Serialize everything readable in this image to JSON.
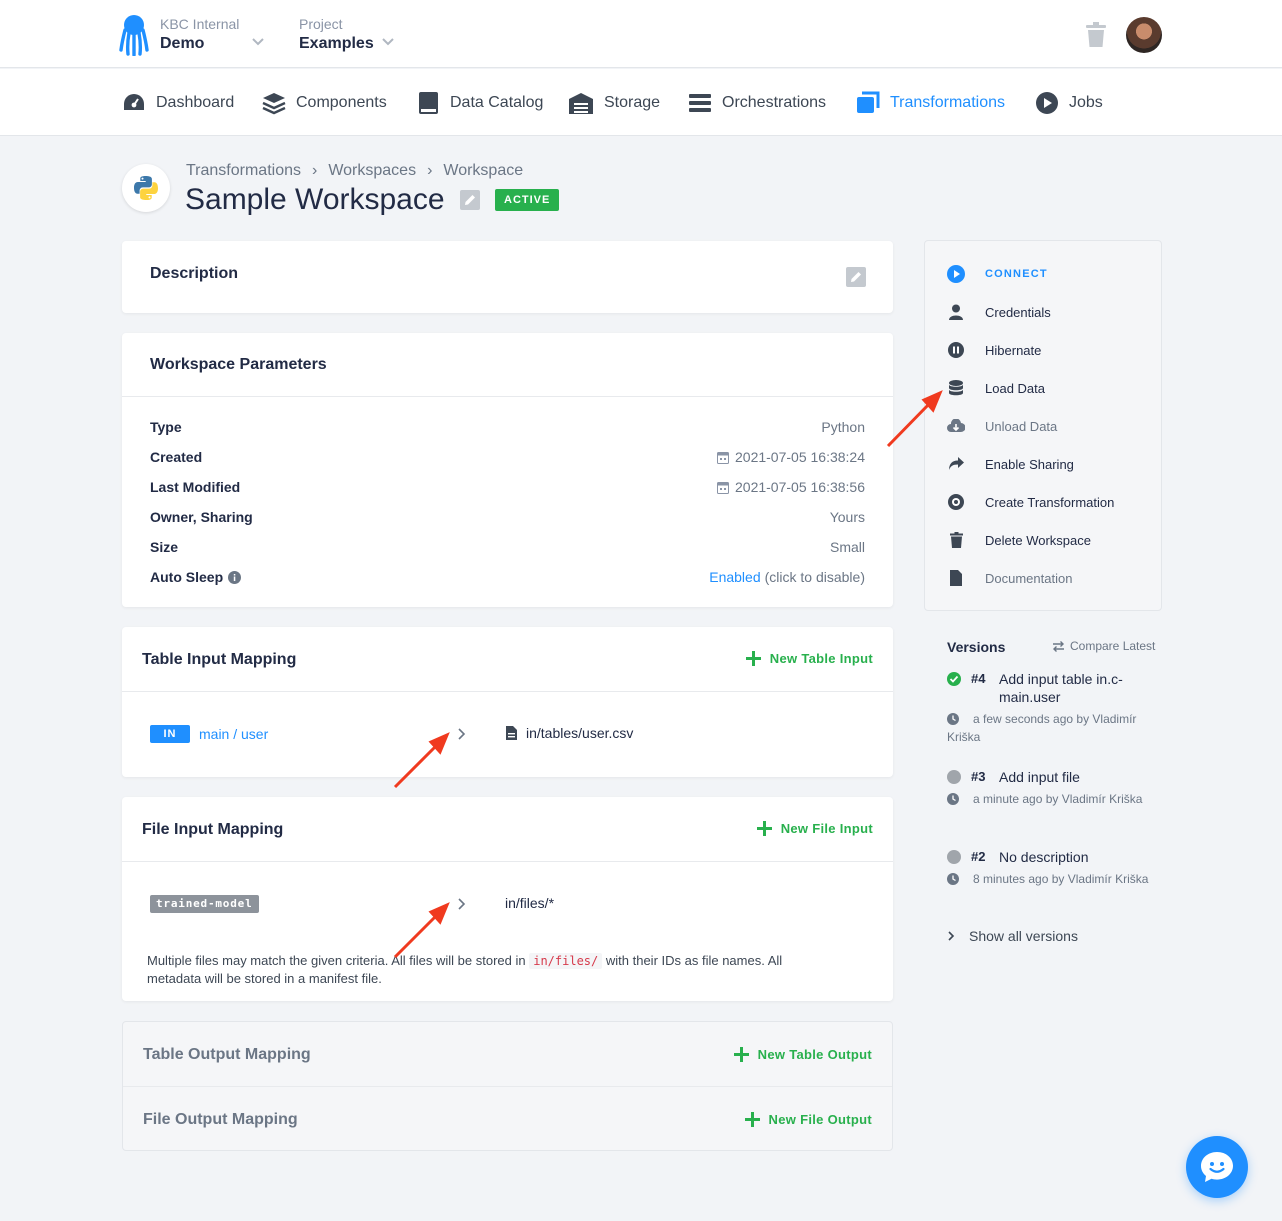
{
  "topbar": {
    "org_label": "KBC Internal",
    "org_value": "Demo",
    "project_label": "Project",
    "project_value": "Examples"
  },
  "nav": {
    "items": [
      {
        "label": "Dashboard",
        "icon": "gauge-icon"
      },
      {
        "label": "Components",
        "icon": "layers-icon"
      },
      {
        "label": "Data Catalog",
        "icon": "book-icon"
      },
      {
        "label": "Storage",
        "icon": "warehouse-icon"
      },
      {
        "label": "Orchestrations",
        "icon": "bars-icon"
      },
      {
        "label": "Transformations",
        "icon": "window-icon",
        "active": true
      },
      {
        "label": "Jobs",
        "icon": "play-icon"
      }
    ]
  },
  "header": {
    "breadcrumb": [
      "Transformations",
      "Workspaces",
      "Workspace"
    ],
    "title": "Sample Workspace",
    "status": "ACTIVE"
  },
  "description": {
    "title": "Description"
  },
  "params": {
    "title": "Workspace Parameters",
    "rows": [
      {
        "key": "Type",
        "value": "Python"
      },
      {
        "key": "Created",
        "value": "2021-07-05 16:38:24"
      },
      {
        "key": "Last Modified",
        "value": "2021-07-05 16:38:56"
      },
      {
        "key": "Owner, Sharing",
        "value": "Yours"
      },
      {
        "key": "Size",
        "value": "Small"
      },
      {
        "key": "Auto Sleep",
        "value_link": "Enabled",
        "value_suffix": "(click to disable)"
      }
    ]
  },
  "table_input": {
    "title": "Table Input Mapping",
    "add_label": "New Table Input",
    "badge": "IN",
    "source": "main / user",
    "destination": "in/tables/user.csv"
  },
  "file_input": {
    "title": "File Input Mapping",
    "add_label": "New File Input",
    "tag": "trained-model",
    "destination": "in/files/*",
    "note_before": "Multiple files may match the given criteria. All files will be stored in",
    "note_code": "in/files/",
    "note_after": "with their IDs as file names. All metadata will be stored in a manifest file."
  },
  "table_output": {
    "title": "Table Output Mapping",
    "add_label": "New Table Output"
  },
  "file_output": {
    "title": "File Output Mapping",
    "add_label": "New File Output"
  },
  "sidebar": {
    "connect": "CONNECT",
    "items": [
      {
        "label": "Credentials",
        "icon": "user-icon"
      },
      {
        "label": "Hibernate",
        "icon": "pause-icon"
      },
      {
        "label": "Load Data",
        "icon": "database-icon"
      },
      {
        "label": "Unload Data",
        "icon": "cloud-download-icon",
        "disabled": true
      },
      {
        "label": "Enable Sharing",
        "icon": "share-icon"
      },
      {
        "label": "Create Transformation",
        "icon": "gear-icon"
      },
      {
        "label": "Delete Workspace",
        "icon": "trash-icon"
      },
      {
        "label": "Documentation",
        "icon": "file-icon",
        "muted": true
      }
    ]
  },
  "versions": {
    "title": "Versions",
    "compare_label": "Compare Latest",
    "list": [
      {
        "num": "#4",
        "desc": "Add input table in.c-main.user",
        "meta": "a few seconds ago by Vladimír Kriška",
        "status": "current",
        "color": "#28b04d"
      },
      {
        "num": "#3",
        "desc": "Add input file",
        "meta": "a minute ago by Vladimír Kriška",
        "status": "old",
        "color": "#a0a5ab"
      },
      {
        "num": "#2",
        "desc": "No description",
        "meta": "8 minutes ago by Vladimír Kriška",
        "status": "old",
        "color": "#a0a5ab"
      }
    ],
    "show_all": "Show all versions"
  },
  "colors": {
    "accent": "#1f8fff",
    "success": "#28b04d",
    "annotation_arrow": "#f03a1f"
  }
}
